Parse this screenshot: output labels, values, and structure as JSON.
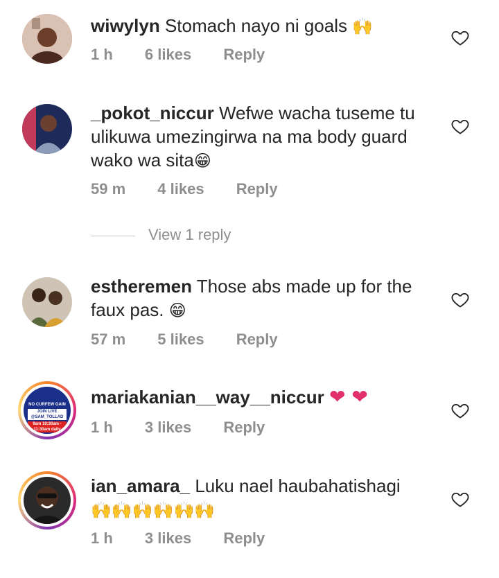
{
  "comments": [
    {
      "username": "wiwylyn",
      "text": "Stomach nayo ni goals",
      "emoji": "🙌",
      "time": "1 h",
      "likes": "6 likes",
      "reply": "Reply"
    },
    {
      "username": "_pokot_niccur",
      "text": "Wefwe wacha tuseme tu ulikuwa umezingirwa na ma body guard wako wa sita",
      "emoji": "😁",
      "time": "59 m",
      "likes": "4 likes",
      "reply": "Reply",
      "view_replies": "View 1 reply"
    },
    {
      "username": "estheremen",
      "text": "Those abs made up for the faux pas.",
      "emoji": "😁",
      "time": "57 m",
      "likes": "5 likes",
      "reply": "Reply"
    },
    {
      "username": "mariakanian__way__niccur",
      "text": "",
      "emoji": "❤ ❤",
      "time": "1 h",
      "likes": "3 likes",
      "reply": "Reply",
      "avatar_lines": [
        "NO CURFEW GAIN",
        "JOIN LIVE @SAM_TOLLAD",
        "9am 10:30am - 11:30am daily"
      ]
    },
    {
      "username": "ian_amara_",
      "text": "Luku nael haubahatishagi",
      "emoji": "🙌🙌🙌🙌🙌🙌",
      "time": "1 h",
      "likes": "3 likes",
      "reply": "Reply"
    }
  ],
  "colors": {
    "text": "#262626",
    "meta": "#8e8e8e",
    "heart_emoji": "#e1306c"
  },
  "icons": {
    "like": "heart-outline-icon"
  }
}
